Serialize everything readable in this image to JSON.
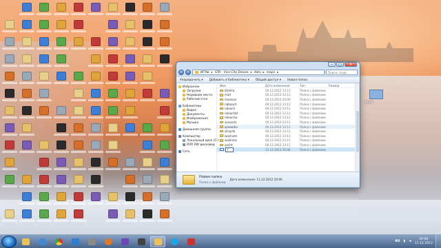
{
  "window": {
    "breadcrumb": [
      "ИГРЫ",
      "GTA - Vice City Deluxe",
      "data",
      "maps"
    ],
    "search_placeholder": "Поиск: maps",
    "toolbar": [
      "Упорядочить ▾",
      "Добавить в библиотеку ▾",
      "Общий доступ ▾",
      "Новая папка"
    ],
    "nav": [
      {
        "label": "Избранное",
        "icon": "star-icon",
        "level": 0
      },
      {
        "label": "Загрузки",
        "icon": "folder-icon",
        "level": 1
      },
      {
        "label": "Недавние места",
        "icon": "folder-icon",
        "level": 1
      },
      {
        "label": "Рабочий стол",
        "icon": "folder-icon",
        "level": 1
      },
      {
        "label": "",
        "icon": "",
        "level": -1
      },
      {
        "label": "Библиотеки",
        "icon": "library-icon",
        "level": 0
      },
      {
        "label": "Видео",
        "icon": "folder-icon",
        "level": 1
      },
      {
        "label": "Документы",
        "icon": "folder-icon",
        "level": 1
      },
      {
        "label": "Изображения",
        "icon": "folder-icon",
        "level": 1
      },
      {
        "label": "Музыка",
        "icon": "folder-icon",
        "level": 1
      },
      {
        "label": "",
        "icon": "",
        "level": -1
      },
      {
        "label": "Домашняя группа",
        "icon": "homegroup-icon",
        "level": 0
      },
      {
        "label": "",
        "icon": "",
        "level": -1
      },
      {
        "label": "Компьютер",
        "icon": "computer-icon",
        "level": 0
      },
      {
        "label": "Локальный диск (C:)",
        "icon": "drive-icon",
        "level": 1
      },
      {
        "label": "DVD RW дисковод",
        "icon": "dvd-icon",
        "level": 1
      },
      {
        "label": "",
        "icon": "",
        "level": -1
      },
      {
        "label": "Сеть",
        "icon": "network-icon",
        "level": 0
      }
    ],
    "columns": [
      "Имя",
      "Дата изменения",
      "Тип",
      "Размер"
    ],
    "files": [
      {
        "name": "littleha",
        "date": "00.12.2012 13:11",
        "type": "Папка с файлами",
        "state": ""
      },
      {
        "name": "mall",
        "date": "00.12.2012 13:11",
        "type": "Папка с файлами",
        "state": ""
      },
      {
        "name": "mansion",
        "date": "00.12.2012 20:00",
        "type": "Папка с файлами",
        "state": ""
      },
      {
        "name": "nbbeach",
        "date": "00.12.2012 13:11",
        "type": "Папка с файлами",
        "state": ""
      },
      {
        "name": "nbeach",
        "date": "00.12.2012 13:11",
        "type": "Папка с файлами",
        "state": ""
      },
      {
        "name": "nbeachbt",
        "date": "00.12.2012 13:11",
        "type": "Папка с файлами",
        "state": ""
      },
      {
        "name": "nbeachw",
        "date": "00.12.2012 13:11",
        "type": "Папка с файлами",
        "state": ""
      },
      {
        "name": "oceandn",
        "date": "00.12.2012 13:11",
        "type": "Папка с файлами",
        "state": ""
      },
      {
        "name": "oceandrv",
        "date": "00.12.2012 13:11",
        "type": "Папка с файлами",
        "state": "hover"
      },
      {
        "name": "stripclb",
        "date": "00.12.2012 13:11",
        "type": "Папка с файлами",
        "state": ""
      },
      {
        "name": "washintn",
        "date": "00.12.2012 13:11",
        "type": "Папка с файлами",
        "state": ""
      },
      {
        "name": "washints",
        "date": "00.12.2012 13:11",
        "type": "Папка с файлами",
        "state": ""
      },
      {
        "name": "yacht",
        "date": "00.12.2012 13:11",
        "type": "Папка с файлами",
        "state": ""
      },
      {
        "name": "Г...",
        "date": "11.12.2012 20:06",
        "type": "Папка с файлами",
        "state": "edit"
      }
    ],
    "details": {
      "name": "Новая папка",
      "subtype": "Папка с файлами",
      "modified": "Дата изменения: 11.12.2012 20:06"
    },
    "caption_buttons": [
      "–",
      "□",
      "✕"
    ]
  },
  "desktop": {
    "rail_icon_label": "ИГРЫ"
  },
  "taskbar": {
    "lang": "RU",
    "time": "20:06",
    "date": "11.12.2012"
  }
}
